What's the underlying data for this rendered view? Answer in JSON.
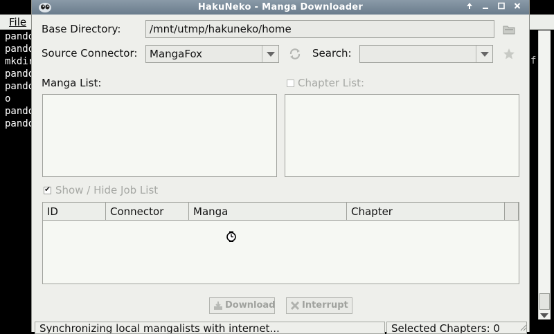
{
  "window": {
    "title": "HakuNeko - Manga Downloader",
    "accent": "#7b8c9b"
  },
  "background_app": {
    "menu_file": "File",
    "terminal_lines": [
      "pando",
      "pando",
      "mkdir",
      "pando",
      "pando",
      "o",
      "pando",
      "pando"
    ],
    "right_letter": "f"
  },
  "base_directory": {
    "label": "Base Directory:",
    "value": "/mnt/utmp/hakuneko/home"
  },
  "source_connector": {
    "label": "Source Connector:",
    "value": "MangaFox"
  },
  "search": {
    "label": "Search:",
    "value": ""
  },
  "manga_list": {
    "label": "Manga List:"
  },
  "chapter_list": {
    "label": "Chapter List:",
    "checked": false
  },
  "job_list_toggle": {
    "label": "Show / Hide Job List",
    "checked": true
  },
  "job_table": {
    "columns": [
      "ID",
      "Connector",
      "Manga",
      "Chapter"
    ]
  },
  "buttons": {
    "download": "Download",
    "interrupt": "Interrupt"
  },
  "status_bar": {
    "message": "Synchronizing local mangalists with internet...",
    "selected": "Selected Chapters: 0"
  }
}
